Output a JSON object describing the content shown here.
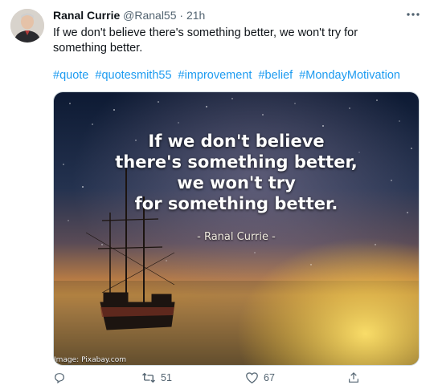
{
  "tweet": {
    "author_name": "Ranal Currie",
    "handle": "@Ranal55",
    "separator": "·",
    "time": "21h",
    "text": "If we don't believe there's something better, we won't try for something better.",
    "hashtags": [
      "#quote",
      "#quotesmith55",
      "#improvement",
      "#belief",
      "#MondayMotivation"
    ]
  },
  "media": {
    "quote_lines": [
      "If we don't believe",
      "there's something better,",
      "we won't try",
      "for something better."
    ],
    "attribution": "- Ranal Currie -",
    "credit": "Image: Pixabay.com"
  },
  "actions": {
    "retweets": "51",
    "likes": "67"
  },
  "icons": {
    "more": "more-horizontal-icon",
    "reply": "reply-icon",
    "retweet": "retweet-icon",
    "like": "heart-icon",
    "share": "share-icon"
  },
  "colors": {
    "accent": "#1d9bf0",
    "muted": "#536471",
    "text": "#0f1419"
  }
}
